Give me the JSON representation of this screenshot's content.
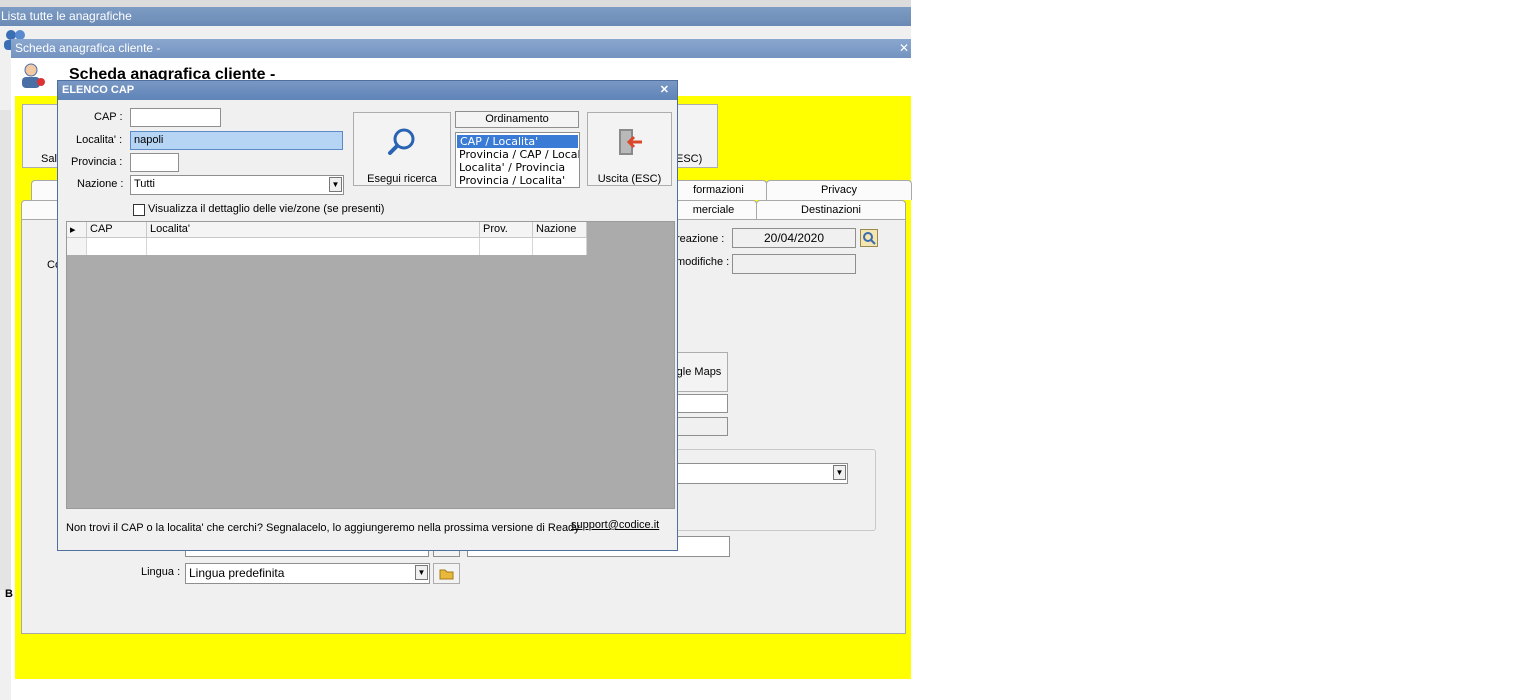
{
  "top_window": {
    "title": "Lista tutte le anagrafiche"
  },
  "customer_window": {
    "title": "Scheda anagrafica cliente -",
    "header_title": "Scheda anagrafica cliente -",
    "save_label_partial": "Salv",
    "exit_label_partial": "ESC)",
    "tabs_row1": [
      "formazioni",
      "Privacy"
    ],
    "tabs_row2": [
      "merciale",
      "Destinazioni"
    ],
    "creation_label": "reazione :",
    "creation_date": "20/04/2020",
    "modified_label": "modifiche :",
    "maps_button": "gle Maps",
    "side_label_partial": "Co",
    "lingua_label": "Lingua :",
    "lingua_value": "Lingua predefinita",
    "bottom_partial": "B"
  },
  "dialog": {
    "title": "ELENCO CAP",
    "cap_label": "CAP :",
    "cap_value": "",
    "localita_label": "Localita' :",
    "localita_value": "napoli",
    "provincia_label": "Provincia :",
    "provincia_value": "",
    "nazione_label": "Nazione :",
    "nazione_value": "Tutti",
    "search_button": "Esegui ricerca",
    "ordering_label": "Ordinamento",
    "ordering_options": [
      "CAP / Localita'",
      "Provincia / CAP / Localita'",
      "Localita' / Provincia",
      "Provincia / Localita'"
    ],
    "exit_button": "Uscita (ESC)",
    "detail_checkbox_label": "Visualizza il dettaglio delle vie/zone (se presenti)",
    "grid_columns": [
      "CAP",
      "Localita'",
      "Prov.",
      "Nazione"
    ],
    "footer_text": "Non trovi il CAP o la localita' che cerchi? Segnalacelo, lo aggiungeremo nella prossima versione di Ready",
    "support_link": "support@codice.it"
  }
}
